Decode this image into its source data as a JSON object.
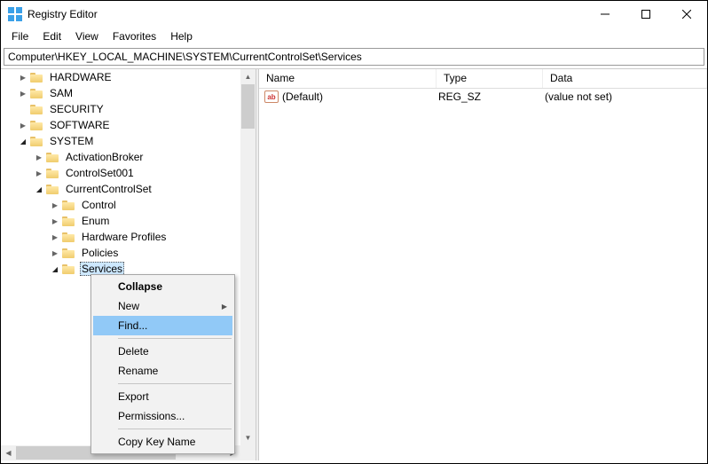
{
  "window": {
    "title": "Registry Editor"
  },
  "menubar": [
    "File",
    "Edit",
    "View",
    "Favorites",
    "Help"
  ],
  "address": "Computer\\HKEY_LOCAL_MACHINE\\SYSTEM\\CurrentControlSet\\Services",
  "tree": [
    {
      "indent": 1,
      "expander": ">",
      "label": "HARDWARE"
    },
    {
      "indent": 1,
      "expander": ">",
      "label": "SAM"
    },
    {
      "indent": 1,
      "expander": "",
      "label": "SECURITY"
    },
    {
      "indent": 1,
      "expander": ">",
      "label": "SOFTWARE"
    },
    {
      "indent": 1,
      "expander": "v",
      "label": "SYSTEM"
    },
    {
      "indent": 2,
      "expander": ">",
      "label": "ActivationBroker"
    },
    {
      "indent": 2,
      "expander": ">",
      "label": "ControlSet001"
    },
    {
      "indent": 2,
      "expander": "v",
      "label": "CurrentControlSet"
    },
    {
      "indent": 3,
      "expander": ">",
      "label": "Control"
    },
    {
      "indent": 3,
      "expander": ">",
      "label": "Enum"
    },
    {
      "indent": 3,
      "expander": ">",
      "label": "Hardware Profiles"
    },
    {
      "indent": 3,
      "expander": ">",
      "label": "Policies"
    },
    {
      "indent": 3,
      "expander": "v",
      "label": "Services",
      "selected": true
    }
  ],
  "list": {
    "cols": [
      "Name",
      "Type",
      "Data"
    ],
    "rows": [
      {
        "icon": "ab",
        "name": "(Default)",
        "type": "REG_SZ",
        "data": "(value not set)"
      }
    ]
  },
  "ctx": {
    "items": [
      {
        "label": "Collapse",
        "bold": true
      },
      {
        "label": "New",
        "sub": true
      },
      {
        "label": "Find...",
        "hover": true
      },
      {
        "sep": true
      },
      {
        "label": "Delete"
      },
      {
        "label": "Rename"
      },
      {
        "sep": true
      },
      {
        "label": "Export"
      },
      {
        "label": "Permissions..."
      },
      {
        "sep": true
      },
      {
        "label": "Copy Key Name"
      }
    ]
  }
}
